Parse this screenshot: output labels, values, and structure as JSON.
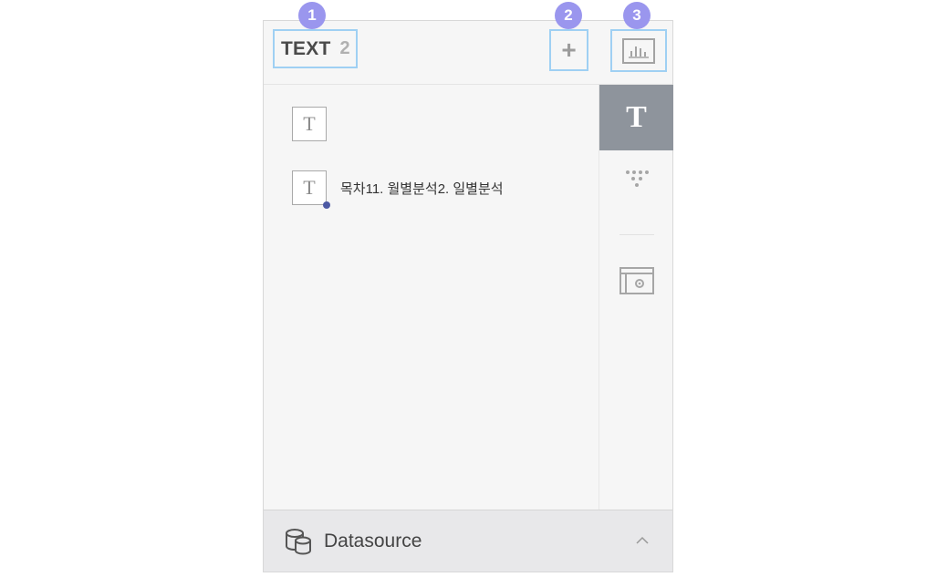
{
  "header": {
    "title": "TEXT",
    "count": "2",
    "add_label": "+"
  },
  "badges": [
    "1",
    "2",
    "3"
  ],
  "list": {
    "items": [
      {
        "icon": "text-icon",
        "glyph": "T",
        "label": "",
        "has_marker": false
      },
      {
        "icon": "text-icon",
        "glyph": "T",
        "label": "목차11. 월별분석2. 일별분석",
        "has_marker": true
      }
    ]
  },
  "side_nav": {
    "text_glyph": "T",
    "items": [
      "text-icon",
      "filter-icon",
      "settings-panel-icon"
    ],
    "active": "text-icon"
  },
  "footer": {
    "label": "Datasource",
    "icon": "database-icon",
    "chevron": "chevron-up-icon"
  },
  "colors": {
    "badge": "#9a96ee",
    "highlight_border": "#9fd0f3",
    "active_side": "#8e949c",
    "marker_dot": "#4d5aa4"
  }
}
